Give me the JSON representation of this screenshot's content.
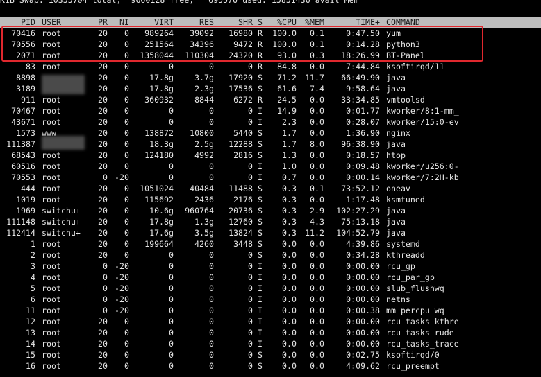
{
  "summary_line": "KiB Swap: 10355704 total,  9660128 free,   695576 used. 15851436 avail Mem",
  "columns": [
    "PID",
    "USER",
    "PR",
    "NI",
    "VIRT",
    "RES",
    "SHR",
    "S",
    "%CPU",
    "%MEM",
    "TIME+",
    "COMMAND"
  ],
  "processes": [
    {
      "pid": "70416",
      "user": "root",
      "pr": "20",
      "ni": "0",
      "virt": "989264",
      "res": "39092",
      "shr": "16980",
      "s": "R",
      "cpu": "100.0",
      "mem": "0.1",
      "time": "0:47.50",
      "cmd": "yum"
    },
    {
      "pid": "70556",
      "user": "root",
      "pr": "20",
      "ni": "0",
      "virt": "251564",
      "res": "34396",
      "shr": "9472",
      "s": "R",
      "cpu": "100.0",
      "mem": "0.1",
      "time": "0:14.28",
      "cmd": "python3"
    },
    {
      "pid": "2071",
      "user": "root",
      "pr": "20",
      "ni": "0",
      "virt": "1358044",
      "res": "110304",
      "shr": "24320",
      "s": "R",
      "cpu": "93.0",
      "mem": "0.3",
      "time": "18:26.99",
      "cmd": "BT-Panel"
    },
    {
      "pid": "83",
      "user": "root",
      "pr": "20",
      "ni": "0",
      "virt": "0",
      "res": "0",
      "shr": "0",
      "s": "R",
      "cpu": "84.8",
      "mem": "0.0",
      "time": "7:44.84",
      "cmd": "ksoftirqd/11"
    },
    {
      "pid": "8898",
      "user": "",
      "pr": "20",
      "ni": "0",
      "virt": "17.8g",
      "res": "3.7g",
      "shr": "17920",
      "s": "S",
      "cpu": "71.2",
      "mem": "11.7",
      "time": "66:49.90",
      "cmd": "java"
    },
    {
      "pid": "3189",
      "user": "",
      "pr": "20",
      "ni": "0",
      "virt": "17.8g",
      "res": "2.3g",
      "shr": "17536",
      "s": "S",
      "cpu": "61.6",
      "mem": "7.4",
      "time": "9:58.64",
      "cmd": "java"
    },
    {
      "pid": "911",
      "user": "root",
      "pr": "20",
      "ni": "0",
      "virt": "360932",
      "res": "8844",
      "shr": "6272",
      "s": "R",
      "cpu": "24.5",
      "mem": "0.0",
      "time": "33:34.85",
      "cmd": "vmtoolsd"
    },
    {
      "pid": "70467",
      "user": "root",
      "pr": "20",
      "ni": "0",
      "virt": "0",
      "res": "0",
      "shr": "0",
      "s": "I",
      "cpu": "14.9",
      "mem": "0.0",
      "time": "0:01.77",
      "cmd": "kworker/8:1-mm_"
    },
    {
      "pid": "43671",
      "user": "root",
      "pr": "20",
      "ni": "0",
      "virt": "0",
      "res": "0",
      "shr": "0",
      "s": "I",
      "cpu": "2.3",
      "mem": "0.0",
      "time": "0:28.07",
      "cmd": "kworker/15:0-ev"
    },
    {
      "pid": "1573",
      "user": "www",
      "pr": "20",
      "ni": "0",
      "virt": "138872",
      "res": "10800",
      "shr": "5440",
      "s": "S",
      "cpu": "1.7",
      "mem": "0.0",
      "time": "1:36.90",
      "cmd": "nginx"
    },
    {
      "pid": "111387",
      "user": "",
      "pr": "20",
      "ni": "0",
      "virt": "18.3g",
      "res": "2.5g",
      "shr": "12288",
      "s": "S",
      "cpu": "1.7",
      "mem": "8.0",
      "time": "96:38.90",
      "cmd": "java"
    },
    {
      "pid": "68543",
      "user": "root",
      "pr": "20",
      "ni": "0",
      "virt": "124180",
      "res": "4992",
      "shr": "2816",
      "s": "S",
      "cpu": "1.3",
      "mem": "0.0",
      "time": "0:18.57",
      "cmd": "htop"
    },
    {
      "pid": "60516",
      "user": "root",
      "pr": "20",
      "ni": "0",
      "virt": "0",
      "res": "0",
      "shr": "0",
      "s": "I",
      "cpu": "1.0",
      "mem": "0.0",
      "time": "0:09.48",
      "cmd": "kworker/u256:0-"
    },
    {
      "pid": "70553",
      "user": "root",
      "pr": "0",
      "ni": "-20",
      "virt": "0",
      "res": "0",
      "shr": "0",
      "s": "I",
      "cpu": "0.7",
      "mem": "0.0",
      "time": "0:00.14",
      "cmd": "kworker/7:2H-kb"
    },
    {
      "pid": "444",
      "user": "root",
      "pr": "20",
      "ni": "0",
      "virt": "1051024",
      "res": "40484",
      "shr": "11488",
      "s": "S",
      "cpu": "0.3",
      "mem": "0.1",
      "time": "73:52.12",
      "cmd": "oneav"
    },
    {
      "pid": "1019",
      "user": "root",
      "pr": "20",
      "ni": "0",
      "virt": "115692",
      "res": "2436",
      "shr": "2176",
      "s": "S",
      "cpu": "0.3",
      "mem": "0.0",
      "time": "1:17.48",
      "cmd": "ksmtuned"
    },
    {
      "pid": "1969",
      "user": "switchu+",
      "pr": "20",
      "ni": "0",
      "virt": "10.6g",
      "res": "960764",
      "shr": "20736",
      "s": "S",
      "cpu": "0.3",
      "mem": "2.9",
      "time": "102:27.29",
      "cmd": "java"
    },
    {
      "pid": "111148",
      "user": "switchu+",
      "pr": "20",
      "ni": "0",
      "virt": "17.8g",
      "res": "1.3g",
      "shr": "12760",
      "s": "S",
      "cpu": "0.3",
      "mem": "4.3",
      "time": "75:13.18",
      "cmd": "java"
    },
    {
      "pid": "112414",
      "user": "switchu+",
      "pr": "20",
      "ni": "0",
      "virt": "17.6g",
      "res": "3.5g",
      "shr": "13824",
      "s": "S",
      "cpu": "0.3",
      "mem": "11.2",
      "time": "104:52.79",
      "cmd": "java"
    },
    {
      "pid": "1",
      "user": "root",
      "pr": "20",
      "ni": "0",
      "virt": "199664",
      "res": "4260",
      "shr": "3448",
      "s": "S",
      "cpu": "0.0",
      "mem": "0.0",
      "time": "4:39.86",
      "cmd": "systemd"
    },
    {
      "pid": "2",
      "user": "root",
      "pr": "20",
      "ni": "0",
      "virt": "0",
      "res": "0",
      "shr": "0",
      "s": "S",
      "cpu": "0.0",
      "mem": "0.0",
      "time": "0:34.28",
      "cmd": "kthreadd"
    },
    {
      "pid": "3",
      "user": "root",
      "pr": "0",
      "ni": "-20",
      "virt": "0",
      "res": "0",
      "shr": "0",
      "s": "I",
      "cpu": "0.0",
      "mem": "0.0",
      "time": "0:00.00",
      "cmd": "rcu_gp"
    },
    {
      "pid": "4",
      "user": "root",
      "pr": "0",
      "ni": "-20",
      "virt": "0",
      "res": "0",
      "shr": "0",
      "s": "I",
      "cpu": "0.0",
      "mem": "0.0",
      "time": "0:00.00",
      "cmd": "rcu_par_gp"
    },
    {
      "pid": "5",
      "user": "root",
      "pr": "0",
      "ni": "-20",
      "virt": "0",
      "res": "0",
      "shr": "0",
      "s": "I",
      "cpu": "0.0",
      "mem": "0.0",
      "time": "0:00.00",
      "cmd": "slub_flushwq"
    },
    {
      "pid": "6",
      "user": "root",
      "pr": "0",
      "ni": "-20",
      "virt": "0",
      "res": "0",
      "shr": "0",
      "s": "I",
      "cpu": "0.0",
      "mem": "0.0",
      "time": "0:00.00",
      "cmd": "netns"
    },
    {
      "pid": "11",
      "user": "root",
      "pr": "0",
      "ni": "-20",
      "virt": "0",
      "res": "0",
      "shr": "0",
      "s": "I",
      "cpu": "0.0",
      "mem": "0.0",
      "time": "0:00.38",
      "cmd": "mm_percpu_wq"
    },
    {
      "pid": "12",
      "user": "root",
      "pr": "20",
      "ni": "0",
      "virt": "0",
      "res": "0",
      "shr": "0",
      "s": "I",
      "cpu": "0.0",
      "mem": "0.0",
      "time": "0:00.00",
      "cmd": "rcu_tasks_kthre"
    },
    {
      "pid": "13",
      "user": "root",
      "pr": "20",
      "ni": "0",
      "virt": "0",
      "res": "0",
      "shr": "0",
      "s": "I",
      "cpu": "0.0",
      "mem": "0.0",
      "time": "0:00.00",
      "cmd": "rcu_tasks_rude_"
    },
    {
      "pid": "14",
      "user": "root",
      "pr": "20",
      "ni": "0",
      "virt": "0",
      "res": "0",
      "shr": "0",
      "s": "I",
      "cpu": "0.0",
      "mem": "0.0",
      "time": "0:00.00",
      "cmd": "rcu_tasks_trace"
    },
    {
      "pid": "15",
      "user": "root",
      "pr": "20",
      "ni": "0",
      "virt": "0",
      "res": "0",
      "shr": "0",
      "s": "S",
      "cpu": "0.0",
      "mem": "0.0",
      "time": "0:02.75",
      "cmd": "ksoftirqd/0"
    },
    {
      "pid": "16",
      "user": "root",
      "pr": "20",
      "ni": "0",
      "virt": "0",
      "res": "0",
      "shr": "0",
      "s": "S",
      "cpu": "0.0",
      "mem": "0.0",
      "time": "4:09.62",
      "cmd": "rcu_preempt"
    }
  ],
  "colors": {
    "background": "#000000",
    "text": "#e6e6e6",
    "header_bg": "#bdbdbd",
    "highlight_box": "#e0282e"
  }
}
